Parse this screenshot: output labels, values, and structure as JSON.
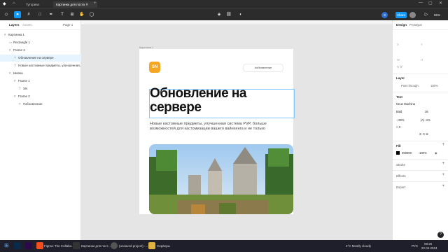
{
  "browser": {
    "tabs": [
      {
        "label": "Туториал"
      },
      {
        "label": "Картинки для поста"
      }
    ]
  },
  "toolbar": {
    "share_label": "Share",
    "zoom": "65%",
    "avatar_initial": "S"
  },
  "left_panel": {
    "tab_layers": "Layers",
    "tab_assets": "Assets",
    "page_label": "Page 1",
    "layers": [
      {
        "label": "Картинка 1",
        "indent": 0,
        "icon": "#"
      },
      {
        "label": "Rectangle 1",
        "indent": 1,
        "icon": "▭"
      },
      {
        "label": "Frame 3",
        "indent": 1,
        "icon": "#"
      },
      {
        "label": "Обновление на сервере",
        "indent": 2,
        "icon": "T",
        "selected": true
      },
      {
        "label": "Новые кастомные предметы, улучшенная...",
        "indent": 2,
        "icon": "T"
      },
      {
        "label": "Шапка",
        "indent": 1,
        "icon": "#"
      },
      {
        "label": "Frame 1",
        "indent": 2,
        "icon": "#"
      },
      {
        "label": "SN",
        "indent": 3,
        "icon": "T"
      },
      {
        "label": "Frame 2",
        "indent": 2,
        "icon": "#"
      },
      {
        "label": "#обновление",
        "indent": 3,
        "icon": "T"
      }
    ]
  },
  "canvas": {
    "frame_label": "Картинка 1",
    "logo_text": "SN",
    "tag_text": "#обновление",
    "heading": "Обновление на сервере",
    "body_text": "Новые кастомные предметы, улучшенная система PVP, больше возможностей для кастомизации вашего вайнхенга и не только"
  },
  "right_panel": {
    "tab_design": "Design",
    "tab_prototype": "Prototype",
    "layer_title": "Layer",
    "pass_through": "Pass through",
    "layer_opacity": "100%",
    "text_title": "Text",
    "font_name": "Neue Machina",
    "font_weight": "Bold",
    "font_size": "36",
    "line_height": "90%",
    "letter_spacing": "-4%",
    "para_spacing": "0",
    "fill_title": "Fill",
    "fill_hex": "000000",
    "fill_opacity": "100%",
    "stroke_title": "Stroke",
    "effects_title": "Effects",
    "export_title": "Export"
  },
  "taskbar": {
    "items": [
      {
        "label": "Figma: The Collabo..."
      },
      {
        "label": "Картинки для пост..."
      },
      {
        "label": "(unsaved project) -..."
      },
      {
        "label": "Серверы"
      }
    ],
    "weather": "4°C  Mostly cloudy",
    "language": "РУС",
    "time": "09:25",
    "date": "22.04.2024"
  },
  "colors": {
    "accent": "#0d99ff",
    "logo": "#f5a623",
    "toolbar": "#2c2c2c"
  }
}
